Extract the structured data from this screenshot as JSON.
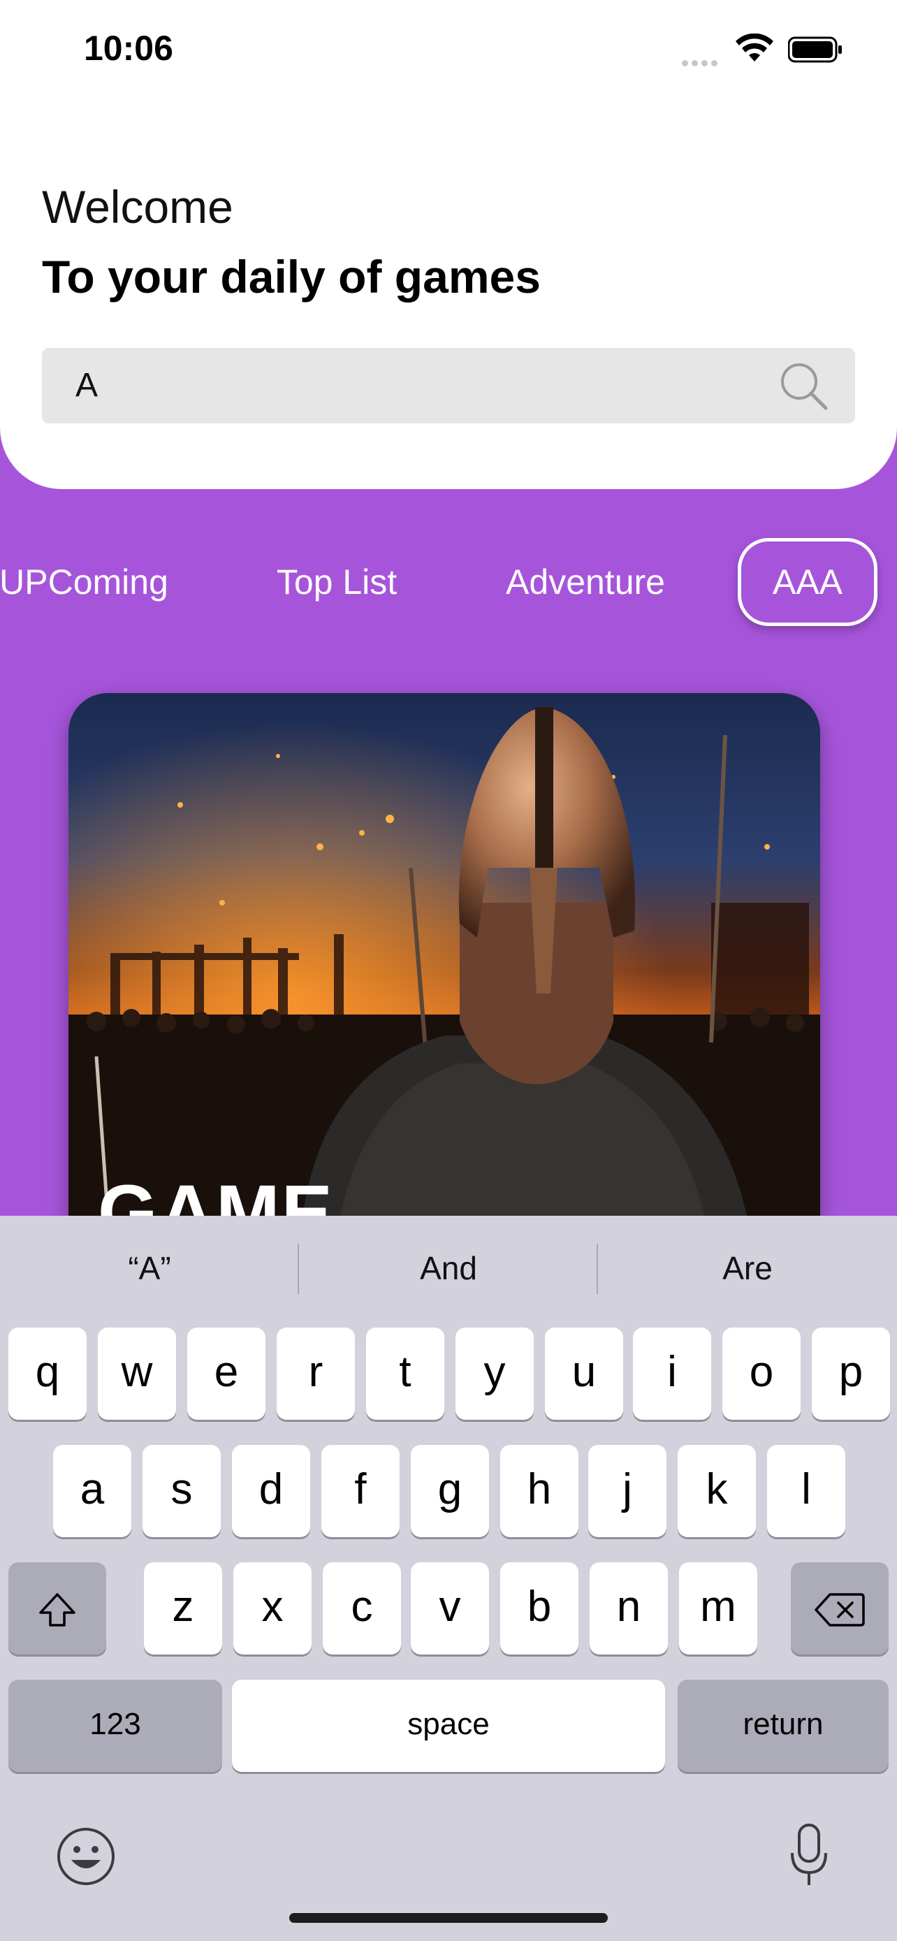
{
  "status_bar": {
    "time": "10:06"
  },
  "header": {
    "welcome": "Welcome",
    "subtitle": "To your daily of games"
  },
  "search": {
    "value": "A"
  },
  "tabs": [
    {
      "label": "UPComing",
      "active": false
    },
    {
      "label": "Top List",
      "active": false
    },
    {
      "label": "Adventure",
      "active": false
    },
    {
      "label": "AAA",
      "active": true
    }
  ],
  "card": {
    "title_partial": "GAME"
  },
  "keyboard": {
    "suggestions": [
      "“A”",
      "And",
      "Are"
    ],
    "row1": [
      "q",
      "w",
      "e",
      "r",
      "t",
      "y",
      "u",
      "i",
      "o",
      "p"
    ],
    "row2": [
      "a",
      "s",
      "d",
      "f",
      "g",
      "h",
      "j",
      "k",
      "l"
    ],
    "row3": [
      "z",
      "x",
      "c",
      "v",
      "b",
      "n",
      "m"
    ],
    "numbers_key": "123",
    "space_key": "space",
    "return_key": "return"
  },
  "colors": {
    "background": "#a655db",
    "card_bg": "#ffffff",
    "search_bg": "#e6e6e6",
    "keyboard_bg": "#d2d1dc"
  }
}
